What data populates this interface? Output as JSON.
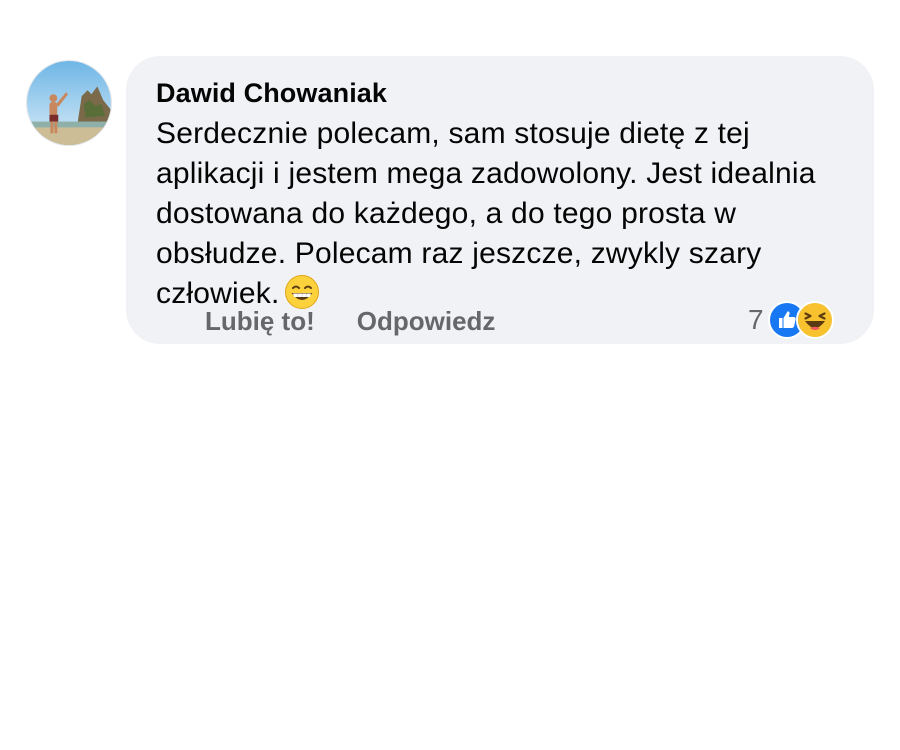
{
  "comment": {
    "author": "Dawid Chowaniak",
    "text": "Serdecznie polecam, sam stosuje dietę z tej aplikacji i jestem mega zadowolony. Jest idealnia dostowana do każdego, a do tego prosta w obsłudze. Polecam raz jeszcze, zwykly szary człowiek.",
    "emoji": "grinning-squinting-face",
    "avatar": "profile-photo"
  },
  "actions": {
    "like_label": "Lubię to!",
    "reply_label": "Odpowiedz"
  },
  "reactions": {
    "count": "7",
    "types": [
      "like",
      "haha"
    ]
  },
  "colors": {
    "bubble_bg": "#f0f2f5",
    "action_text": "#65676b",
    "like_blue": "#1877f2",
    "haha_yellow": "#f7c22e"
  }
}
